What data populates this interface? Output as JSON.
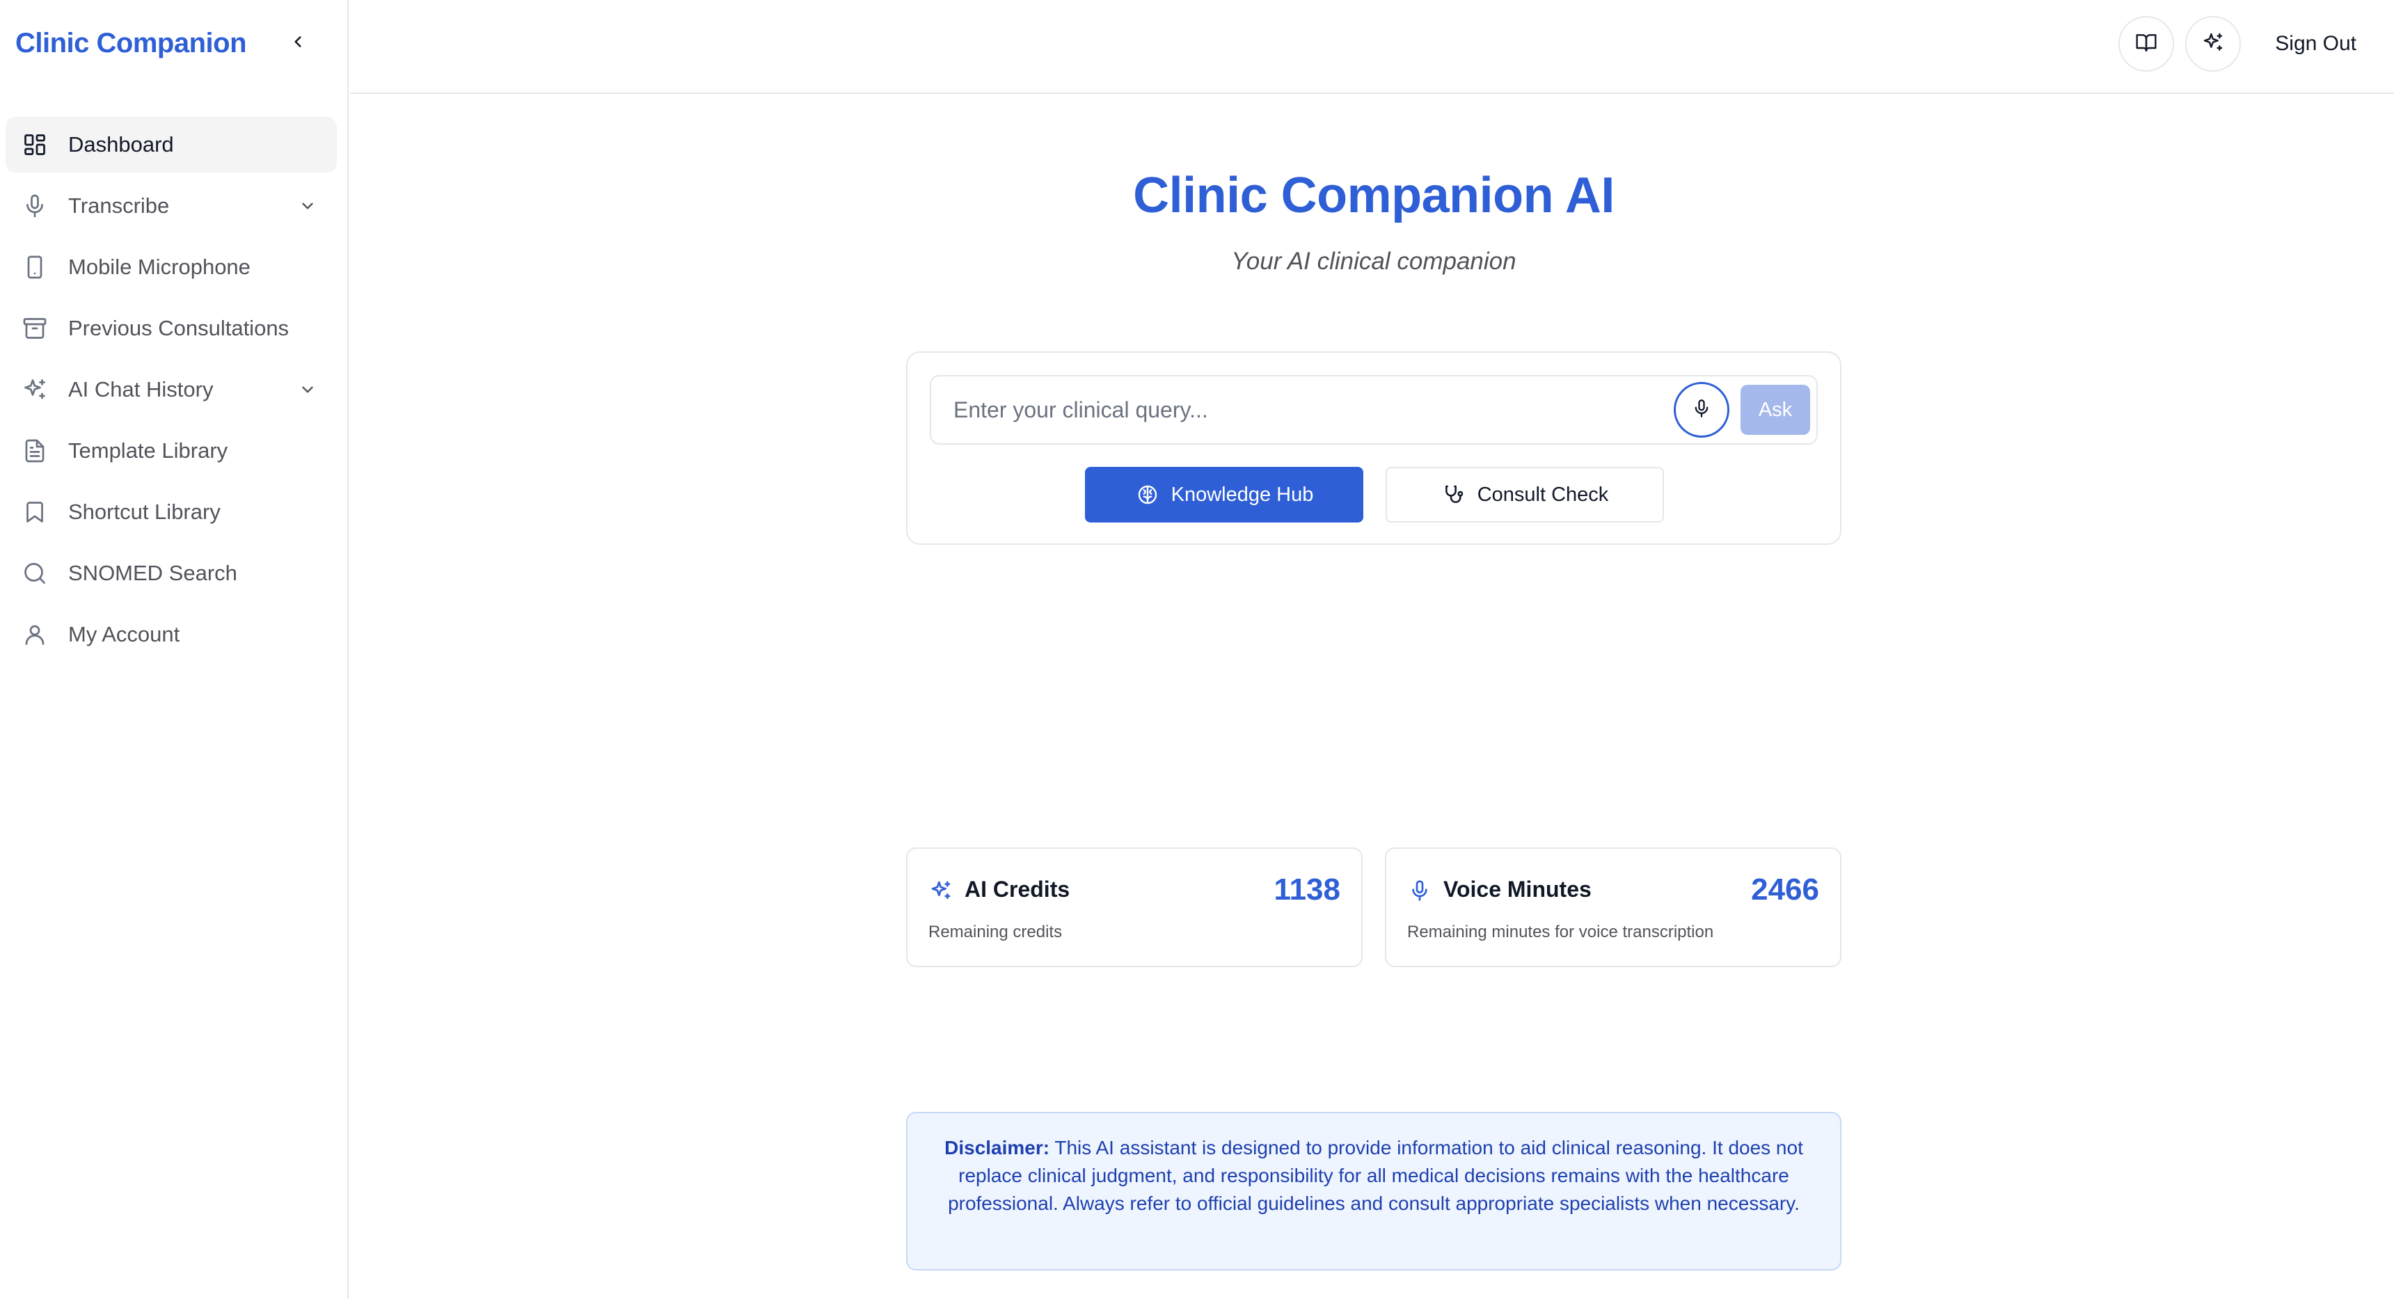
{
  "app": {
    "brand": "Clinic Companion"
  },
  "sidebar": {
    "items": [
      {
        "label": "Dashboard",
        "icon": "dashboard-icon",
        "active": true
      },
      {
        "label": "Transcribe",
        "icon": "microphone-icon",
        "expandable": true
      },
      {
        "label": "Mobile Microphone",
        "icon": "mobile-icon"
      },
      {
        "label": "Previous Consultations",
        "icon": "archive-icon"
      },
      {
        "label": "AI Chat History",
        "icon": "sparkles-icon",
        "expandable": true
      },
      {
        "label": "Template Library",
        "icon": "document-icon"
      },
      {
        "label": "Shortcut Library",
        "icon": "bookmark-icon"
      },
      {
        "label": "SNOMED Search",
        "icon": "search-icon"
      },
      {
        "label": "My Account",
        "icon": "user-icon"
      }
    ]
  },
  "topbar": {
    "signout_label": "Sign Out"
  },
  "main": {
    "title": "Clinic Companion AI",
    "subtitle": "Your AI clinical companion",
    "query": {
      "placeholder": "Enter your clinical query...",
      "value": "",
      "ask_label": "Ask"
    },
    "buttons": {
      "knowledge_hub": "Knowledge Hub",
      "consult_check": "Consult Check"
    },
    "stats": {
      "ai_credits": {
        "title": "AI Credits",
        "value": "1138",
        "description": "Remaining credits"
      },
      "voice_minutes": {
        "title": "Voice Minutes",
        "value": "2466",
        "description": "Remaining minutes for voice transcription"
      }
    },
    "disclaimer": {
      "label": "Disclaimer:",
      "text": "This AI assistant is designed to provide information to aid clinical reasoning. It does not replace clinical judgment, and responsibility for all medical decisions remains with the healthcare professional. Always refer to official guidelines and consult appropriate specialists when necessary."
    }
  },
  "colors": {
    "accent": "#2f5fd6",
    "ask_disabled": "#a5b8ec",
    "disclaimer_bg": "#eff5ff",
    "disclaimer_text": "#1e40af"
  }
}
